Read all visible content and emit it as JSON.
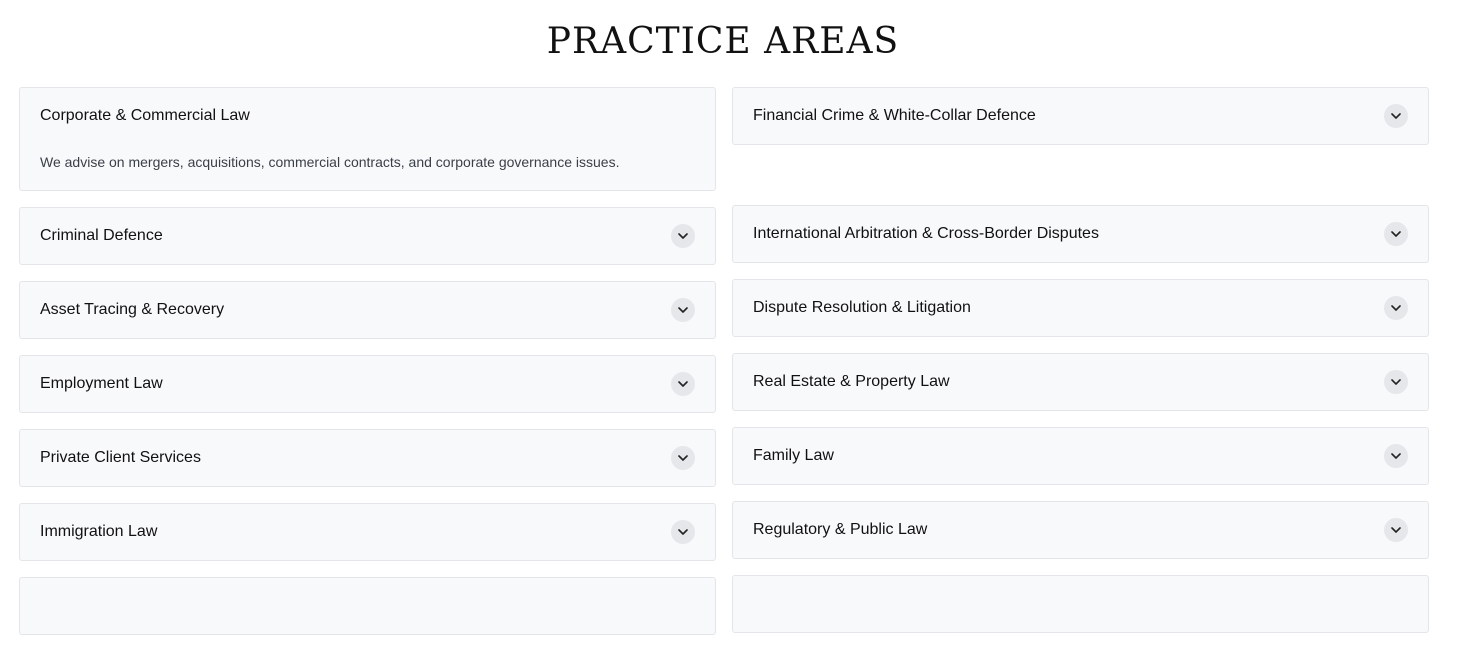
{
  "page": {
    "title": "PRACTICE AREAS"
  },
  "colors": {
    "card_bg": "#f8f9fb",
    "card_border": "#e3e5e8",
    "chevron_bg": "#e6e7ea",
    "text": "#111111",
    "body_text": "#3a3f47"
  },
  "practice_areas": {
    "left": [
      {
        "title": "Corporate & Commercial Law",
        "expanded": true,
        "description": "We advise on mergers, acquisitions, commercial contracts, and corporate governance issues."
      },
      {
        "title": "Criminal Defence",
        "expanded": false
      },
      {
        "title": "Asset Tracing & Recovery",
        "expanded": false
      },
      {
        "title": "Employment Law",
        "expanded": false
      },
      {
        "title": "Private Client Services",
        "expanded": false
      },
      {
        "title": "Immigration Law",
        "expanded": false
      },
      {
        "title": "",
        "expanded": false
      }
    ],
    "right": [
      {
        "title": "Financial Crime & White-Collar Defence",
        "expanded": false
      },
      {
        "title": "International Arbitration & Cross-Border Disputes",
        "expanded": false
      },
      {
        "title": "Dispute Resolution & Litigation",
        "expanded": false
      },
      {
        "title": "Real Estate & Property Law",
        "expanded": false
      },
      {
        "title": "Family Law",
        "expanded": false
      },
      {
        "title": "Regulatory & Public Law",
        "expanded": false
      },
      {
        "title": "",
        "expanded": false
      }
    ]
  },
  "icons": {
    "toggle": "chevron-down-icon"
  }
}
